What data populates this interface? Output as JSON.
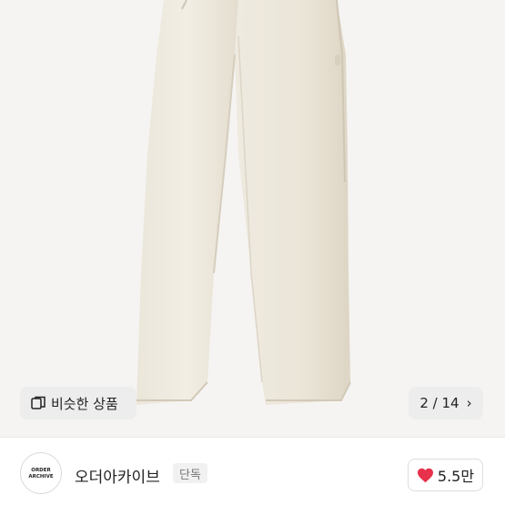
{
  "gallery": {
    "similar_label": "비슷한 상품",
    "counter": "2 / 14"
  },
  "store": {
    "name": "오더아카이브",
    "badge": "단독",
    "logo_text": [
      "ORDER",
      "ARCHIVE"
    ]
  },
  "like": {
    "count": "5.5만",
    "accent_color": "#e8314a"
  },
  "icons": {
    "similar": "square-stack-icon",
    "next": "chevron-right-icon",
    "like": "heart-icon"
  }
}
